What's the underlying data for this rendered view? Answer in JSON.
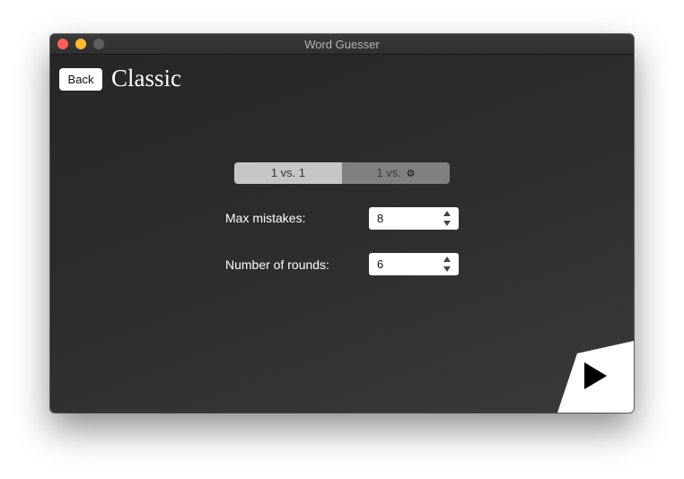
{
  "window": {
    "title": "Word Guesser"
  },
  "header": {
    "back_label": "Back",
    "title": "Classic"
  },
  "mode": {
    "options": [
      {
        "label": "1 vs. 1",
        "suffix_icon": ""
      },
      {
        "label": "1 vs.",
        "suffix_icon": "chip-icon"
      }
    ],
    "chip_glyph": "⚙",
    "selected_index": 0
  },
  "settings": {
    "max_mistakes_label": "Max mistakes:",
    "max_mistakes_value": "8",
    "rounds_label": "Number of rounds:",
    "rounds_value": "6"
  },
  "icons": {
    "play": "play-icon"
  },
  "colors": {
    "close": "#fc5f57",
    "minimize": "#fdbc2e",
    "zoom": "#5e5e5e",
    "background": "#2c2c2c"
  }
}
